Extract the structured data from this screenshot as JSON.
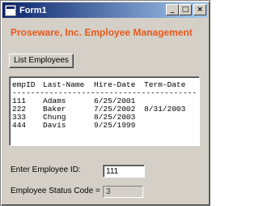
{
  "window": {
    "title": "Form1",
    "minimize_glyph": "_",
    "maximize_glyph": "□",
    "close_glyph": "×"
  },
  "heading": "Proseware, Inc. Employee Management",
  "list_button_label": "List Employees",
  "employee_list": {
    "header": [
      "empID",
      "Last-Name",
      "Hire-Date",
      "Term-Date"
    ],
    "separator": "------------------------------------------",
    "rows": [
      [
        "111",
        "Adams",
        "6/25/2001",
        ""
      ],
      [
        "222",
        "Baker",
        "7/25/2002",
        "8/31/2003"
      ],
      [
        "333",
        "Chung",
        "8/25/2003",
        ""
      ],
      [
        "444",
        "Davis",
        "9/25/1999",
        ""
      ]
    ]
  },
  "employee_id": {
    "label": "Enter Employee ID:",
    "value": "111"
  },
  "status_code": {
    "label": "Employee Status Code =",
    "value": "3"
  },
  "colors": {
    "heading": "#e8571a",
    "face": "#d4d0c8",
    "titlebar": "#0a246a"
  }
}
